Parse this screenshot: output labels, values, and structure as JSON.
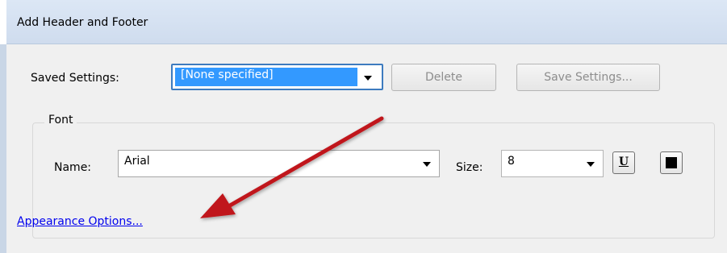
{
  "window": {
    "title": "Add Header and Footer"
  },
  "saved_settings": {
    "label": "Saved Settings:",
    "selected_value": "[None specified]",
    "delete_label": "Delete",
    "save_label": "Save Settings..."
  },
  "font": {
    "group_label": "Font",
    "name_label": "Name:",
    "name_value": "Arial",
    "size_label": "Size:",
    "size_value": "8",
    "underline_glyph": "U",
    "text_color": "#000000"
  },
  "links": {
    "appearance_options": "Appearance Options..."
  },
  "colors": {
    "selection_highlight": "#3399ff",
    "focus_border": "#3d7bbf",
    "link": "#0000ee",
    "annotation_arrow": "#c0191c"
  },
  "icons": {
    "dropdown": "chevron-down-icon",
    "underline": "underline-icon",
    "color": "color-swatch-icon",
    "annotation": "arrow-annotation"
  }
}
